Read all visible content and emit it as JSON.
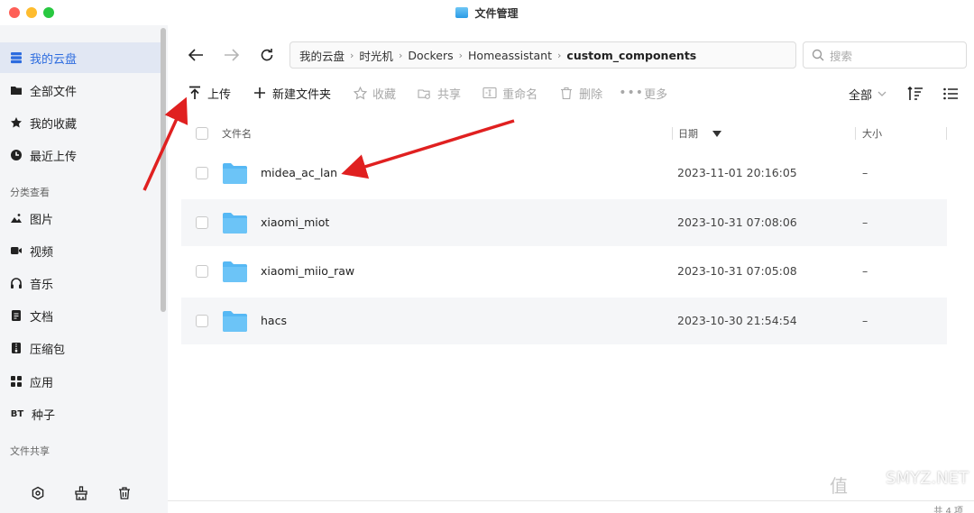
{
  "window": {
    "title": "文件管理"
  },
  "sidebar": {
    "items": [
      {
        "label": "我的云盘",
        "icon": "storage-icon",
        "active": true
      },
      {
        "label": "全部文件",
        "icon": "folder-icon"
      },
      {
        "label": "我的收藏",
        "icon": "star-icon"
      },
      {
        "label": "最近上传",
        "icon": "clock-icon"
      }
    ],
    "section_category": "分类查看",
    "categories": [
      {
        "label": "图片",
        "icon": "image-icon"
      },
      {
        "label": "视频",
        "icon": "video-icon"
      },
      {
        "label": "音乐",
        "icon": "headphones-icon"
      },
      {
        "label": "文档",
        "icon": "document-icon"
      },
      {
        "label": "压缩包",
        "icon": "archive-icon"
      },
      {
        "label": "应用",
        "icon": "apps-icon"
      },
      {
        "label": "种子",
        "icon": "torrent-icon",
        "prefix": "BT"
      }
    ],
    "section_share": "文件共享"
  },
  "nav": {
    "breadcrumb": [
      "我的云盘",
      "时光机",
      "Dockers",
      "Homeassistant",
      "custom_components"
    ],
    "search_placeholder": "搜索"
  },
  "toolbar": {
    "upload": "上传",
    "new_folder": "新建文件夹",
    "favorite": "收藏",
    "share": "共享",
    "rename": "重命名",
    "delete": "删除",
    "more": "更多",
    "filter": "全部"
  },
  "table": {
    "headers": {
      "name": "文件名",
      "date": "日期",
      "size": "大小"
    },
    "rows": [
      {
        "name": "midea_ac_lan",
        "date": "2023-11-01 20:16:05",
        "size": "–"
      },
      {
        "name": "xiaomi_miot",
        "date": "2023-10-31 07:08:06",
        "size": "–"
      },
      {
        "name": "xiaomi_miio_raw",
        "date": "2023-10-31 07:05:08",
        "size": "–"
      },
      {
        "name": "hacs",
        "date": "2023-10-30 21:54:54",
        "size": "–"
      }
    ]
  },
  "status": {
    "count": "共 4 项"
  },
  "watermark": {
    "text": "SMYZ.NET"
  },
  "colors": {
    "accent": "#2d6cdf",
    "folder": "#56b8f4",
    "arrow": "#e02020"
  }
}
